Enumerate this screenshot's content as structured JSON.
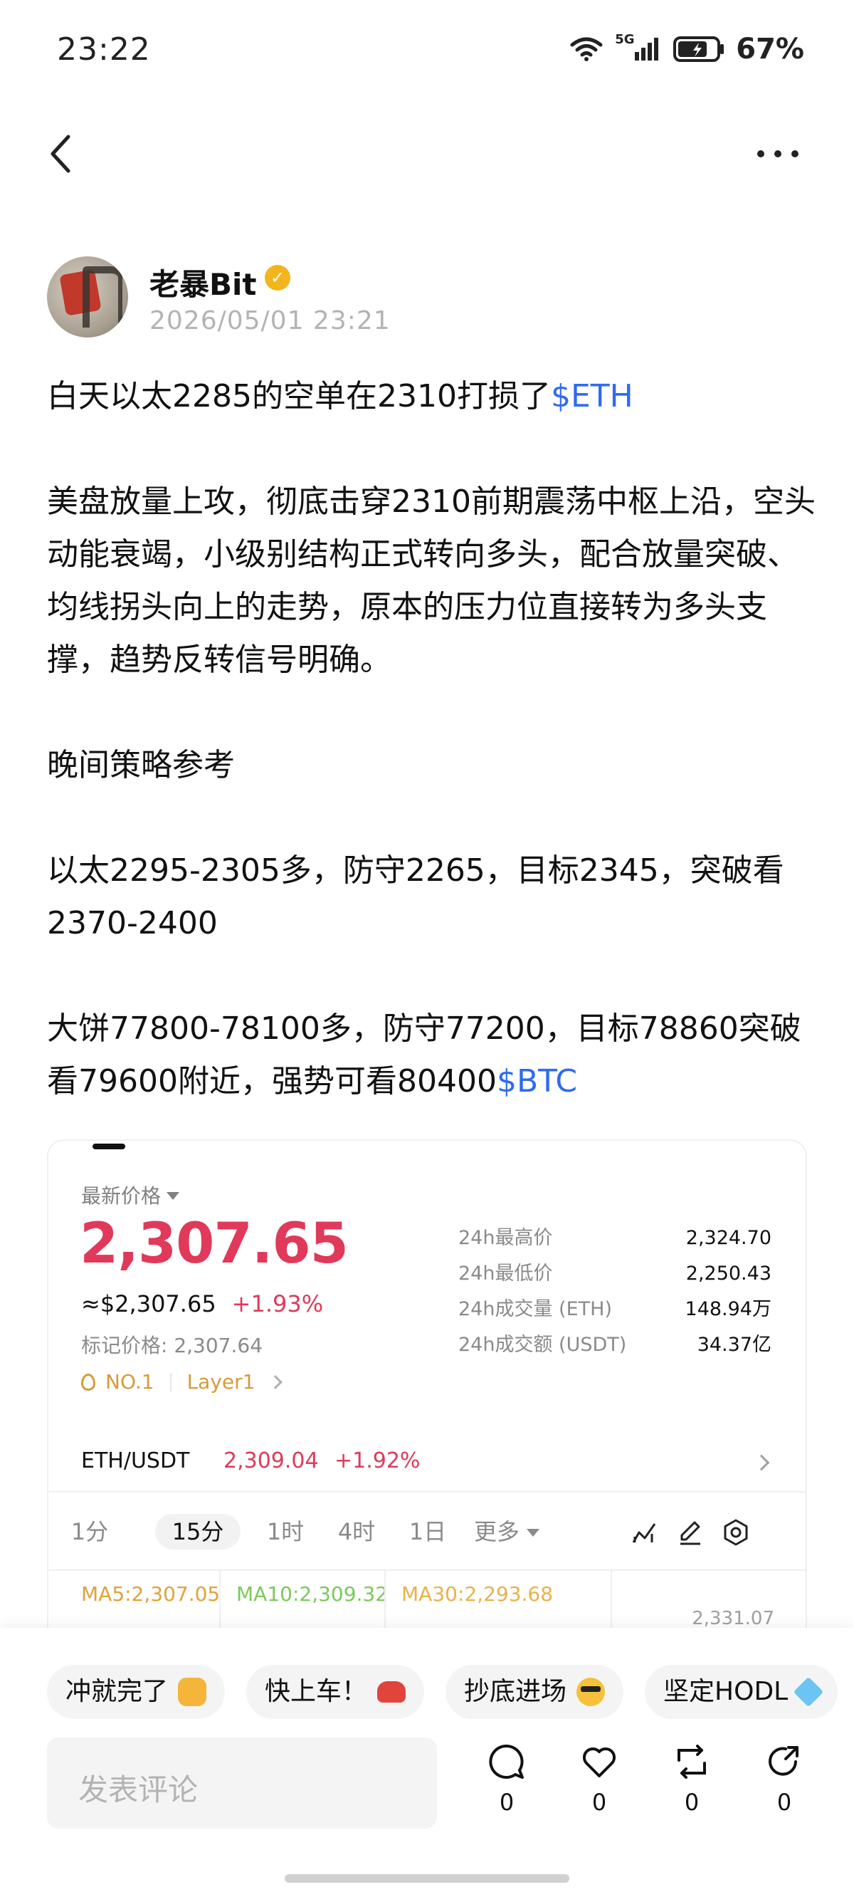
{
  "status_bar": {
    "time": "23:22",
    "network": "5G",
    "battery": "67%"
  },
  "nav": {
    "back_icon": "chevron-left-icon",
    "more_icon": "more-horizontal-icon"
  },
  "author": {
    "name": "老暴Bit",
    "verified_icon": "verified-badge-icon",
    "timestamp": "2026/05/01 23:21"
  },
  "post": {
    "p1": {
      "text": "白天以太2285的空单在2310打损了",
      "tag": "$ETH"
    },
    "p2": "美盘放量上攻，彻底击穿2310前期震荡中枢上沿，空头动能衰竭，小级别结构正式转向多头，配合放量突破、均线拐头向上的走势，原本的压力位直接转为多头支撑，趋势反转信号明确。",
    "p3": "晚间策略参考",
    "p4": "以太2295-2305多，防守2265，目标2345，突破看2370-2400",
    "p5": {
      "text": "大饼77800-78100多，防守77200，目标78860突破看79600附近，强势可看80400",
      "tag": "$BTC"
    }
  },
  "market": {
    "latest_label": "最新价格",
    "price": "2,307.65",
    "fiat_price": "≈$2,307.65",
    "change": "+1.93%",
    "mark_price": "标记价格: 2,307.64",
    "chip_rank": "NO.1",
    "chip_category": "Layer1",
    "stats": [
      {
        "label": "24h最高价",
        "value": "2,324.70"
      },
      {
        "label": "24h最低价",
        "value": "2,250.43"
      },
      {
        "label": "24h成交量 (ETH)",
        "value": "148.94万"
      },
      {
        "label": "24h成交额 (USDT)",
        "value": "34.37亿"
      }
    ],
    "pair": {
      "name": "ETH/USDT",
      "price": "2,309.04",
      "change": "+1.92%"
    },
    "intervals": [
      "1分",
      "15分",
      "1时",
      "4时",
      "1日",
      "更多"
    ],
    "active_interval": "15分",
    "tools": [
      "indicator-icon",
      "draw-icon",
      "settings-icon"
    ],
    "ma": {
      "ma5": "MA5:2,307.05",
      "ma10": "MA10:2,309.32",
      "ma30": "MA30:2,293.68",
      "axis_value": "2,331.07"
    },
    "colors": {
      "up": "#e0395a",
      "ma5": "#e0a23a",
      "ma10": "#7bc95b",
      "ma30": "#e8b24a"
    }
  },
  "reactions": [
    {
      "label": "冲就完了",
      "icon": "fist-emoji-icon"
    },
    {
      "label": "快上车！",
      "icon": "car-emoji-icon"
    },
    {
      "label": "抄底进场",
      "icon": "sunglasses-emoji-icon"
    },
    {
      "label": "坚定HODL",
      "icon": "gem-emoji-icon"
    }
  ],
  "comment": {
    "placeholder": "发表评论"
  },
  "actions": [
    {
      "icon": "comment-icon",
      "count": "0"
    },
    {
      "icon": "like-icon",
      "count": "0"
    },
    {
      "icon": "repost-icon",
      "count": "0"
    },
    {
      "icon": "share-icon",
      "count": "0"
    }
  ]
}
